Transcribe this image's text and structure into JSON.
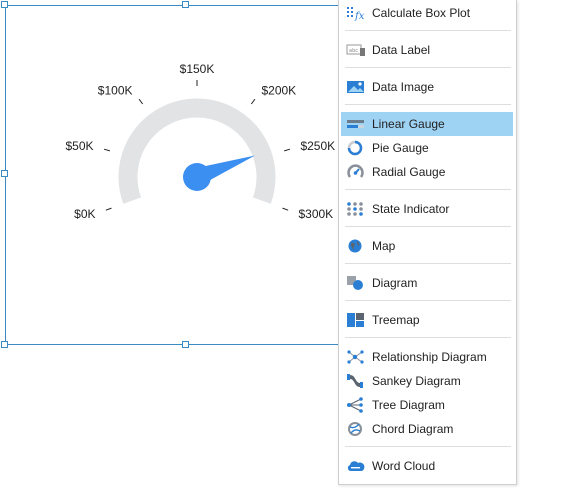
{
  "gauge": {
    "min": 0,
    "max": 300000,
    "value": 245000,
    "start_angle_deg": 200,
    "end_angle_deg": -20,
    "tick_labels": [
      "$0K",
      "$50K",
      "$100K",
      "$150K",
      "$200K",
      "$250K",
      "$300K"
    ],
    "colors": {
      "track": "#e2e3e5",
      "needle": "#3b8ff0",
      "selection_border": "#3a8bc4"
    }
  },
  "menu": {
    "items": [
      {
        "label": "Calculate Box Plot",
        "icon": "box-plot-fx-icon",
        "active": false
      },
      {
        "label": "Data Label",
        "icon": "data-label-icon",
        "active": false
      },
      {
        "label": "Data Image",
        "icon": "data-image-icon",
        "active": false
      },
      {
        "label": "Linear Gauge",
        "icon": "linear-gauge-icon",
        "active": true
      },
      {
        "label": "Pie Gauge",
        "icon": "pie-gauge-icon",
        "active": false
      },
      {
        "label": "Radial Gauge",
        "icon": "radial-gauge-icon",
        "active": false
      },
      {
        "label": "State Indicator",
        "icon": "state-indicator-icon",
        "active": false
      },
      {
        "label": "Map",
        "icon": "map-globe-icon",
        "active": false
      },
      {
        "label": "Diagram",
        "icon": "diagram-icon",
        "active": false
      },
      {
        "label": "Treemap",
        "icon": "treemap-icon",
        "active": false
      },
      {
        "label": "Relationship Diagram",
        "icon": "relationship-diagram-icon",
        "active": false
      },
      {
        "label": "Sankey Diagram",
        "icon": "sankey-diagram-icon",
        "active": false
      },
      {
        "label": "Tree Diagram",
        "icon": "tree-diagram-icon",
        "active": false
      },
      {
        "label": "Chord Diagram",
        "icon": "chord-diagram-icon",
        "active": false
      },
      {
        "label": "Word Cloud",
        "icon": "word-cloud-icon",
        "active": false
      }
    ],
    "colors": {
      "highlight": "#9fd3f4",
      "icon_blue": "#2a7fd4"
    }
  }
}
